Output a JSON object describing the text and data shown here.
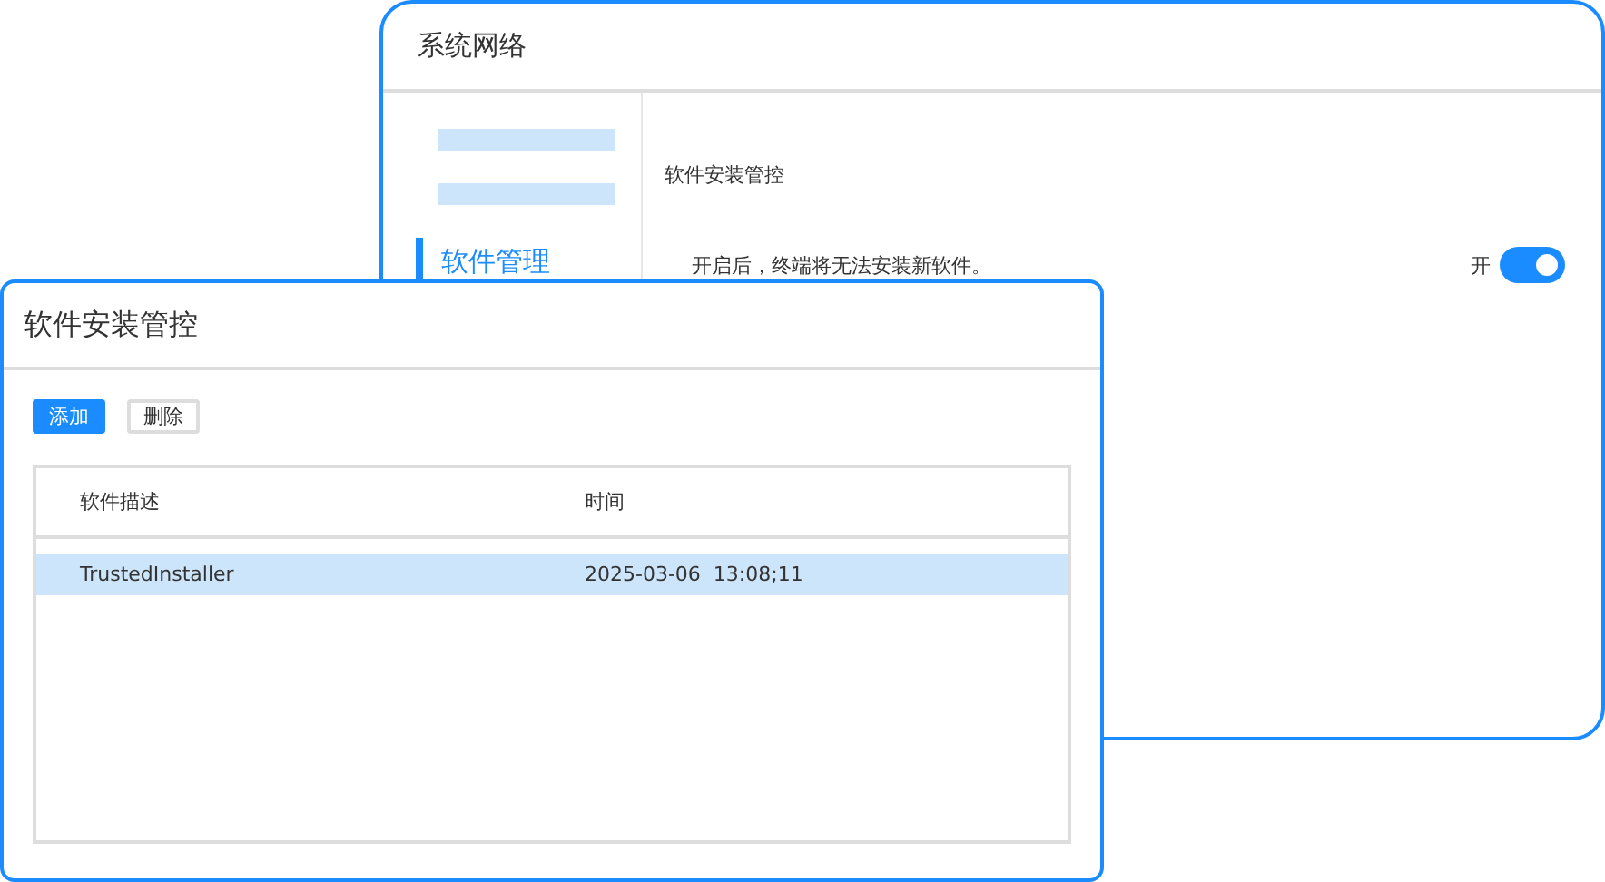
{
  "back_window": {
    "title": "系统网络",
    "sidebar": {
      "items": [
        {
          "kind": "redacted",
          "selected": false
        },
        {
          "kind": "redacted",
          "selected": false
        },
        {
          "kind": "item",
          "label": "软件管理",
          "selected": true
        }
      ]
    },
    "section_title": "软件安装管控",
    "setting": {
      "description": "开启后，终端将无法安装新软件。",
      "toggle_label": "开",
      "on": true
    }
  },
  "front_window": {
    "title": "软件安装管控",
    "buttons": [
      {
        "label": "添加",
        "kind": "primary"
      },
      {
        "label": "删除",
        "kind": "default"
      }
    ],
    "table": {
      "columns": [
        "软件描述",
        "时间"
      ],
      "rows": [
        {
          "cells": [
            "TrustedInstaller",
            "2025-03-06  13:08;11"
          ],
          "selected": true
        }
      ]
    }
  }
}
